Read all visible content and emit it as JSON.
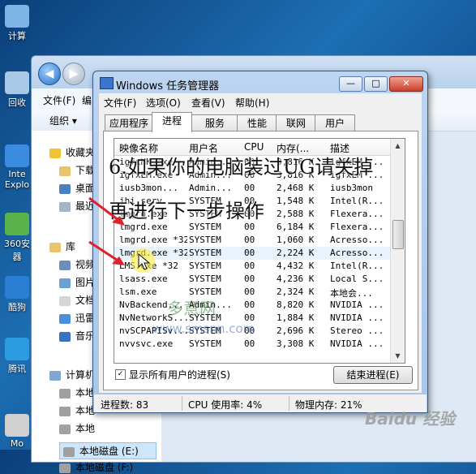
{
  "desktop": {
    "icons": [
      {
        "label": "计算",
        "color": "#7fb4e6"
      },
      {
        "label": "回收",
        "color": "#a8c8e8"
      },
      {
        "label": "Inte Explo",
        "color": "#3b8be0"
      },
      {
        "label": "360安 器",
        "color": "#59b34a"
      },
      {
        "label": "酷狗",
        "color": "#2a7fd4"
      },
      {
        "label": "腾讯",
        "color": "#2d9be0"
      },
      {
        "label": "Mo",
        "color": "#d0d0d0"
      }
    ]
  },
  "explorer": {
    "menu": [
      "文件(F)",
      "编"
    ],
    "toolbar_organize": "组织 ▾",
    "sidebar": [
      {
        "label": "收藏夹",
        "icon": "star-icon",
        "color": "#f1c232"
      },
      {
        "label": "下载",
        "icon": "download-folder-icon",
        "color": "#e8c56a"
      },
      {
        "label": "桌面",
        "icon": "desktop-folder-icon",
        "color": "#4a7fc0"
      },
      {
        "label": "最近",
        "icon": "recent-folder-icon",
        "color": "#9fb5cc"
      },
      {
        "label": "库",
        "icon": "library-icon",
        "color": "#e8c56a"
      },
      {
        "label": "视频",
        "icon": "video-library-icon",
        "color": "#6a8fbf"
      },
      {
        "label": "图片",
        "icon": "picture-library-icon",
        "color": "#6a9fd4"
      },
      {
        "label": "文档",
        "icon": "document-library-icon",
        "color": "#d6d6d6"
      },
      {
        "label": "迅雷",
        "icon": "thunder-icon",
        "color": "#4a90d9"
      },
      {
        "label": "音乐",
        "icon": "music-library-icon",
        "color": "#3b73c4"
      },
      {
        "label": "计算机",
        "icon": "computer-icon",
        "color": "#7fa7d1"
      },
      {
        "label": "本地",
        "icon": "drive-icon",
        "color": "#a0a0a0"
      },
      {
        "label": "本地",
        "icon": "drive-icon",
        "color": "#a0a0a0"
      },
      {
        "label": "本地",
        "icon": "drive-icon",
        "color": "#a0a0a0"
      },
      {
        "label": "本地磁盘 (E:)",
        "icon": "drive-icon",
        "color": "#a0a0a0"
      },
      {
        "label": "本地磁盘 (F:)",
        "icon": "drive-icon",
        "color": "#a0a0a0"
      }
    ]
  },
  "taskmgr": {
    "title": "Windows 任务管理器",
    "window_controls": {
      "minimize": "—",
      "maximize": "□",
      "close": "✕"
    },
    "menu": [
      "文件(F)",
      "选项(O)",
      "查看(V)",
      "帮助(H)"
    ],
    "tabs": [
      "应用程序",
      "进程",
      "服务",
      "性能",
      "联网",
      "用户"
    ],
    "active_tab": "进程",
    "columns": [
      "映像名称",
      "用户名",
      "CPU",
      "内存(...",
      "描述"
    ],
    "rows": [
      [
        "igfxHK.exe",
        "Admin...",
        "00",
        "3,816 K",
        "igfxEM ..."
      ],
      [
        "igfxEM.exe",
        "Admin...",
        "00",
        "3,816 K",
        "igfxEM ..."
      ],
      [
        "iusb3mon...",
        "Admin...",
        "00",
        "2,468 K",
        "iusb3mon"
      ],
      [
        "jhi_serv...",
        "SYSTEM",
        "00",
        "1,548 K",
        "Intel(R..."
      ],
      [
        "lmgrd.exe",
        "SYSTEM",
        "00",
        "2,588 K",
        "Flexera..."
      ],
      [
        "lmgrd.exe",
        "SYSTEM",
        "00",
        "6,184 K",
        "Flexera..."
      ],
      [
        "lmgrd.exe *32",
        "SYSTEM",
        "00",
        "1,060 K",
        "Acresso..."
      ],
      [
        "lmgrd.exe *32",
        "SYSTEM",
        "00",
        "2,224 K",
        "Acresso..."
      ],
      [
        "LMS.exe *32",
        "SYSTEM",
        "00",
        "4,432 K",
        "Intel(R..."
      ],
      [
        "lsass.exe",
        "SYSTEM",
        "00",
        "4,236 K",
        "Local S..."
      ],
      [
        "lsm.exe",
        "SYSTEM",
        "00",
        "2,324 K",
        "本地会..."
      ],
      [
        "NvBackend...",
        "Admin...",
        "00",
        "8,820 K",
        "NVIDIA ..."
      ],
      [
        "NvNetworkS...",
        "SYSTEM",
        "00",
        "1,884 K",
        "NVIDIA ..."
      ],
      [
        "nvSCPAPISv...",
        "SYSTEM",
        "00",
        "2,696 K",
        "Stereo ..."
      ],
      [
        "nvvsvc.exe",
        "SYSTEM",
        "00",
        "3,308 K",
        "NVIDIA ..."
      ]
    ],
    "selected_row": 7,
    "show_all_label": "显示所有用户的进程(S)",
    "show_all_checked": "✓",
    "end_process_label": "结束进程(E)",
    "status": {
      "processes": "进程数: 83",
      "cpu": "CPU 使用率: 4%",
      "memory": "物理内存: 21%"
    }
  },
  "overlay": {
    "caption_line1": "6.如果你的电脑装过UG请关掉",
    "caption_line2": "再进行下一步操作",
    "watermark_text": "多意网",
    "watermark_url": "www.smsnn.com",
    "brand_mark": "Baidu 经验"
  }
}
